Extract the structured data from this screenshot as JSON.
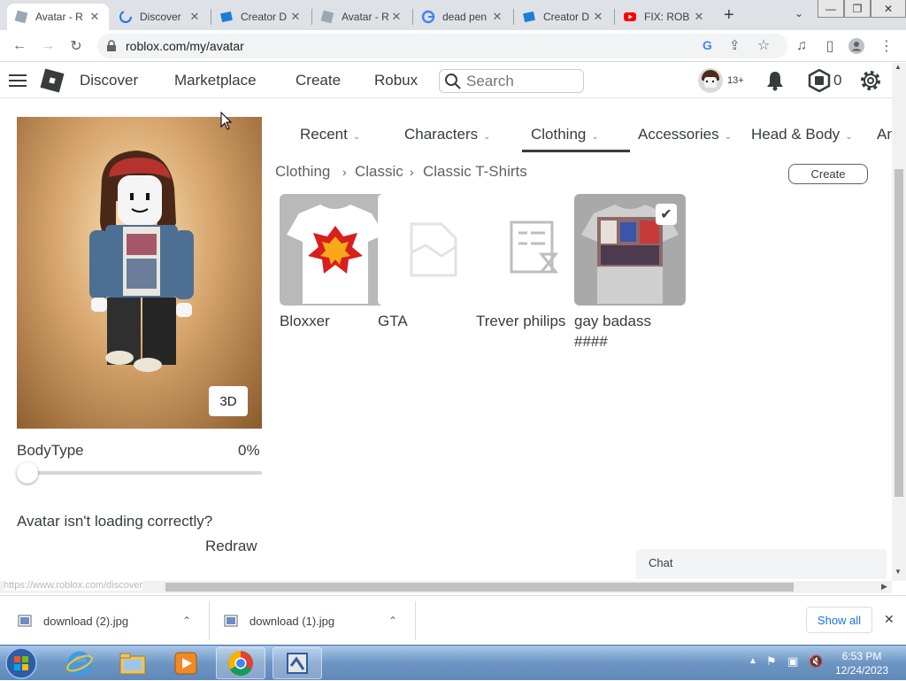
{
  "browser": {
    "tabs": [
      {
        "title": "Avatar - R",
        "icon": "roblox-tab-icon",
        "active": true
      },
      {
        "title": "Discover",
        "icon": "loading-tab-icon",
        "active": false
      },
      {
        "title": "Creator D",
        "icon": "roblox-studio-tab-icon",
        "active": false
      },
      {
        "title": "Avatar - R",
        "icon": "roblox-tab-icon",
        "active": false
      },
      {
        "title": "dead pen",
        "icon": "google-tab-icon",
        "active": false
      },
      {
        "title": "Creator D",
        "icon": "roblox-studio-tab-icon",
        "active": false
      },
      {
        "title": "FIX: ROB",
        "icon": "youtube-tab-icon",
        "active": false
      }
    ],
    "new_tab": "+",
    "url": "roblox.com/my/avatar",
    "status_url": "https://www.roblox.com/discover"
  },
  "header": {
    "nav": [
      "Discover",
      "Marketplace",
      "Create",
      "Robux"
    ],
    "search_placeholder": "Search",
    "age_badge": "13+",
    "robux_count": "0"
  },
  "avatar": {
    "btn_3d": "3D",
    "body_type_label": "BodyType",
    "body_type_value": "0%",
    "body_type_level": 0,
    "loading_issue": "Avatar isn't loading correctly?",
    "redraw": "Redraw"
  },
  "categories": [
    {
      "label": "Recent"
    },
    {
      "label": "Characters"
    },
    {
      "label": "Clothing"
    },
    {
      "label": "Accessories"
    },
    {
      "label": "Head & Body"
    },
    {
      "label": "An"
    }
  ],
  "breadcrumb": [
    "Clothing",
    "Classic",
    "Classic T-Shirts"
  ],
  "create_label": "Create",
  "items": [
    {
      "name": "Bloxxer",
      "selected": false
    },
    {
      "name": "GTA",
      "selected": false
    },
    {
      "name": "Trever philips",
      "selected": false
    },
    {
      "name": "gay badass ####",
      "selected": true
    }
  ],
  "chat_label": "Chat",
  "downloads": [
    {
      "name": "download (2).jpg"
    },
    {
      "name": "download (1).jpg"
    }
  ],
  "show_all": "Show all",
  "clock": {
    "time": "6:53 PM",
    "date": "12/24/2023"
  },
  "colors": {
    "roblox_dark": "#393b3d",
    "link_blue": "#1a73e8",
    "tab_bar": "#dee1e6"
  }
}
